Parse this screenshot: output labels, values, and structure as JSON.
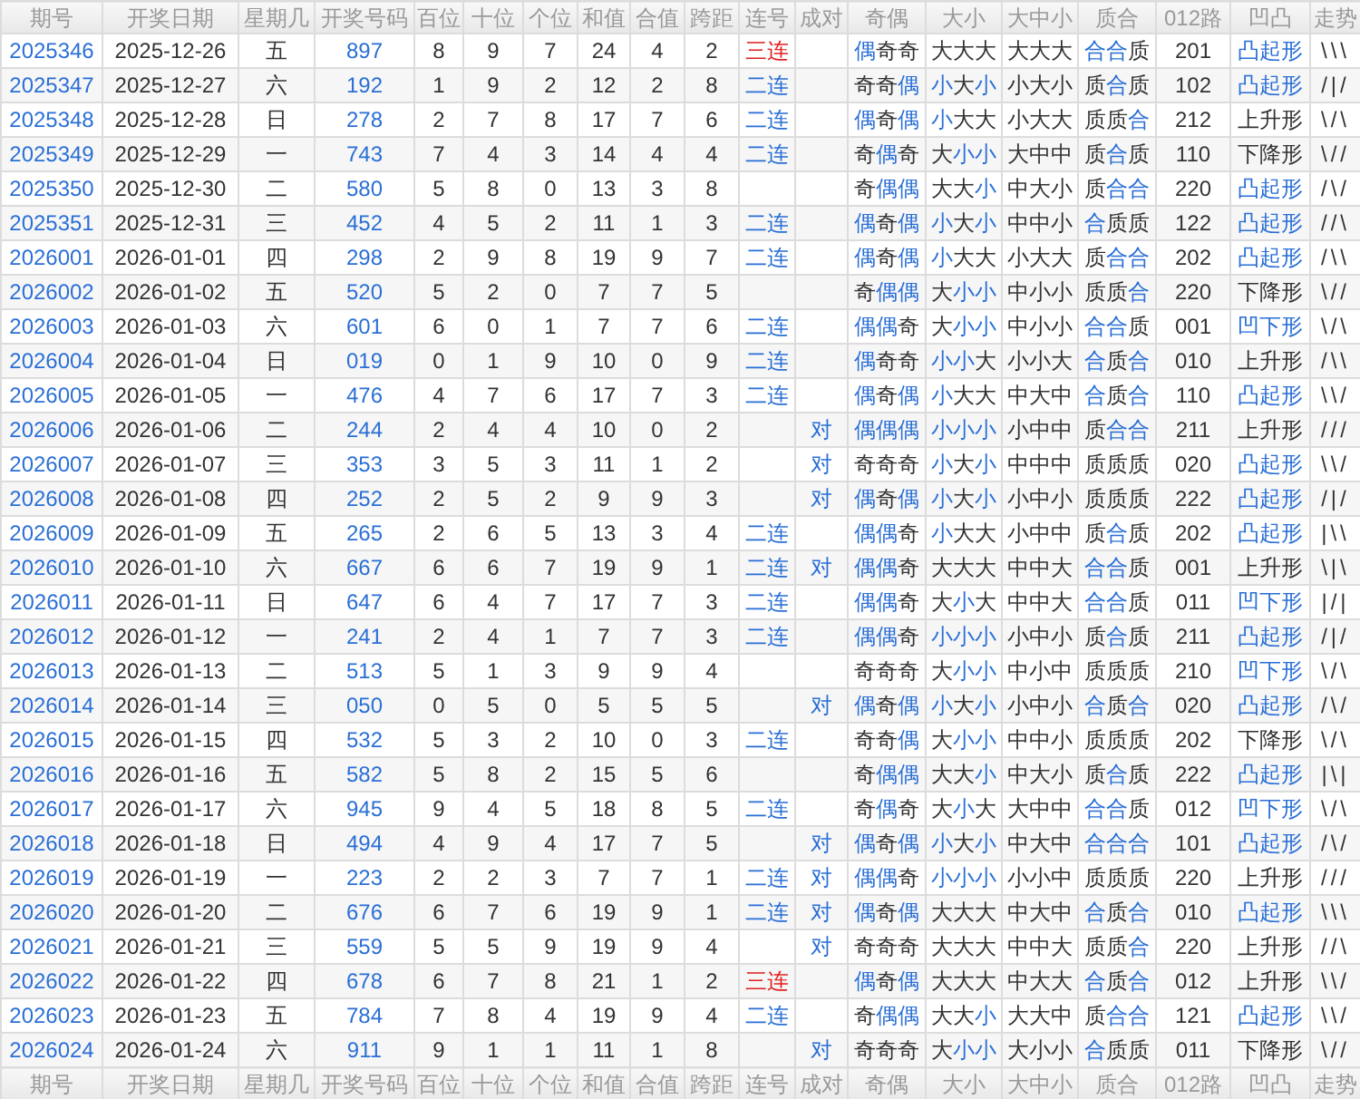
{
  "header": [
    "期号",
    "开奖日期",
    "星期几",
    "开奖号码",
    "百位",
    "十位",
    "个位",
    "和值",
    "合值",
    "跨距",
    "连号",
    "成对",
    "奇偶",
    "大小",
    "大中小",
    "质合",
    "012路",
    "凹凸",
    "走势"
  ],
  "rows": [
    {
      "issue": "2025346",
      "date": "2025-12-26",
      "weekday": "五",
      "number": "897",
      "hundreds": "8",
      "tens": "9",
      "units": "7",
      "sum": "24",
      "sum_tail": "4",
      "span": "2",
      "run": {
        "text": "三连",
        "kind": "triple"
      },
      "odd_even": {
        "text": "偶奇奇",
        "highlighted": [
          true,
          false,
          false
        ]
      },
      "big_small": {
        "text": "大大大",
        "highlighted": [
          false,
          false,
          false
        ]
      },
      "big_mid_small": "大大大",
      "prime_composite": {
        "text": "合合质",
        "highlighted": [
          true,
          true,
          false
        ]
      },
      "road_012": "201",
      "shape": {
        "text": "凸起形",
        "highlighted": true
      },
      "trend": "\\\\\\"
    },
    {
      "issue": "2025347",
      "date": "2025-12-27",
      "weekday": "六",
      "number": "192",
      "hundreds": "1",
      "tens": "9",
      "units": "2",
      "sum": "12",
      "sum_tail": "2",
      "span": "8",
      "run": {
        "text": "二连",
        "kind": "double"
      },
      "odd_even": {
        "text": "奇奇偶",
        "highlighted": [
          false,
          false,
          true
        ]
      },
      "big_small": {
        "text": "小大小",
        "highlighted": [
          true,
          false,
          true
        ]
      },
      "big_mid_small": "小大小",
      "prime_composite": {
        "text": "质合质",
        "highlighted": [
          false,
          true,
          false
        ]
      },
      "road_012": "102",
      "shape": {
        "text": "凸起形",
        "highlighted": true
      },
      "trend": "/|/"
    },
    {
      "issue": "2025348",
      "date": "2025-12-28",
      "weekday": "日",
      "number": "278",
      "hundreds": "2",
      "tens": "7",
      "units": "8",
      "sum": "17",
      "sum_tail": "7",
      "span": "6",
      "run": {
        "text": "二连",
        "kind": "double"
      },
      "odd_even": {
        "text": "偶奇偶",
        "highlighted": [
          true,
          false,
          true
        ]
      },
      "big_small": {
        "text": "小大大",
        "highlighted": [
          true,
          false,
          false
        ]
      },
      "big_mid_small": "小大大",
      "prime_composite": {
        "text": "质质合",
        "highlighted": [
          false,
          false,
          true
        ]
      },
      "road_012": "212",
      "shape": {
        "text": "上升形",
        "highlighted": false
      },
      "trend": "\\/\\"
    },
    {
      "issue": "2025349",
      "date": "2025-12-29",
      "weekday": "一",
      "number": "743",
      "hundreds": "7",
      "tens": "4",
      "units": "3",
      "sum": "14",
      "sum_tail": "4",
      "span": "4",
      "run": {
        "text": "二连",
        "kind": "double"
      },
      "odd_even": {
        "text": "奇偶奇",
        "highlighted": [
          false,
          true,
          false
        ]
      },
      "big_small": {
        "text": "大小小",
        "highlighted": [
          false,
          true,
          true
        ]
      },
      "big_mid_small": "大中中",
      "prime_composite": {
        "text": "质合质",
        "highlighted": [
          false,
          true,
          false
        ]
      },
      "road_012": "110",
      "shape": {
        "text": "下降形",
        "highlighted": false
      },
      "trend": "\\//"
    },
    {
      "issue": "2025350",
      "date": "2025-12-30",
      "weekday": "二",
      "number": "580",
      "hundreds": "5",
      "tens": "8",
      "units": "0",
      "sum": "13",
      "sum_tail": "3",
      "span": "8",
      "odd_even": {
        "text": "奇偶偶",
        "highlighted": [
          false,
          true,
          true
        ]
      },
      "big_small": {
        "text": "大大小",
        "highlighted": [
          false,
          false,
          true
        ]
      },
      "big_mid_small": "中大小",
      "prime_composite": {
        "text": "质合合",
        "highlighted": [
          false,
          true,
          true
        ]
      },
      "road_012": "220",
      "shape": {
        "text": "凸起形",
        "highlighted": true
      },
      "trend": "/\\/"
    },
    {
      "issue": "2025351",
      "date": "2025-12-31",
      "weekday": "三",
      "number": "452",
      "hundreds": "4",
      "tens": "5",
      "units": "2",
      "sum": "11",
      "sum_tail": "1",
      "span": "3",
      "run": {
        "text": "二连",
        "kind": "double"
      },
      "odd_even": {
        "text": "偶奇偶",
        "highlighted": [
          true,
          false,
          true
        ]
      },
      "big_small": {
        "text": "小大小",
        "highlighted": [
          true,
          false,
          true
        ]
      },
      "big_mid_small": "中中小",
      "prime_composite": {
        "text": "合质质",
        "highlighted": [
          true,
          false,
          false
        ]
      },
      "road_012": "122",
      "shape": {
        "text": "凸起形",
        "highlighted": true
      },
      "trend": "//\\"
    },
    {
      "issue": "2026001",
      "date": "2026-01-01",
      "weekday": "四",
      "number": "298",
      "hundreds": "2",
      "tens": "9",
      "units": "8",
      "sum": "19",
      "sum_tail": "9",
      "span": "7",
      "run": {
        "text": "二连",
        "kind": "double"
      },
      "odd_even": {
        "text": "偶奇偶",
        "highlighted": [
          true,
          false,
          true
        ]
      },
      "big_small": {
        "text": "小大大",
        "highlighted": [
          true,
          false,
          false
        ]
      },
      "big_mid_small": "小大大",
      "prime_composite": {
        "text": "质合合",
        "highlighted": [
          false,
          true,
          true
        ]
      },
      "road_012": "202",
      "shape": {
        "text": "凸起形",
        "highlighted": true
      },
      "trend": "/\\\\"
    },
    {
      "issue": "2026002",
      "date": "2026-01-02",
      "weekday": "五",
      "number": "520",
      "hundreds": "5",
      "tens": "2",
      "units": "0",
      "sum": "7",
      "sum_tail": "7",
      "span": "5",
      "odd_even": {
        "text": "奇偶偶",
        "highlighted": [
          false,
          true,
          true
        ]
      },
      "big_small": {
        "text": "大小小",
        "highlighted": [
          false,
          true,
          true
        ]
      },
      "big_mid_small": "中小小",
      "prime_composite": {
        "text": "质质合",
        "highlighted": [
          false,
          false,
          true
        ]
      },
      "road_012": "220",
      "shape": {
        "text": "下降形",
        "highlighted": false
      },
      "trend": "\\//"
    },
    {
      "issue": "2026003",
      "date": "2026-01-03",
      "weekday": "六",
      "number": "601",
      "hundreds": "6",
      "tens": "0",
      "units": "1",
      "sum": "7",
      "sum_tail": "7",
      "span": "6",
      "run": {
        "text": "二连",
        "kind": "double"
      },
      "odd_even": {
        "text": "偶偶奇",
        "highlighted": [
          true,
          true,
          false
        ]
      },
      "big_small": {
        "text": "大小小",
        "highlighted": [
          false,
          true,
          true
        ]
      },
      "big_mid_small": "中小小",
      "prime_composite": {
        "text": "合合质",
        "highlighted": [
          true,
          true,
          false
        ]
      },
      "road_012": "001",
      "shape": {
        "text": "凹下形",
        "highlighted": true
      },
      "trend": "\\/\\"
    },
    {
      "issue": "2026004",
      "date": "2026-01-04",
      "weekday": "日",
      "number": "019",
      "hundreds": "0",
      "tens": "1",
      "units": "9",
      "sum": "10",
      "sum_tail": "0",
      "span": "9",
      "run": {
        "text": "二连",
        "kind": "double"
      },
      "odd_even": {
        "text": "偶奇奇",
        "highlighted": [
          true,
          false,
          false
        ]
      },
      "big_small": {
        "text": "小小大",
        "highlighted": [
          true,
          true,
          false
        ]
      },
      "big_mid_small": "小小大",
      "prime_composite": {
        "text": "合质合",
        "highlighted": [
          true,
          false,
          true
        ]
      },
      "road_012": "010",
      "shape": {
        "text": "上升形",
        "highlighted": false
      },
      "trend": "/\\\\"
    },
    {
      "issue": "2026005",
      "date": "2026-01-05",
      "weekday": "一",
      "number": "476",
      "hundreds": "4",
      "tens": "7",
      "units": "6",
      "sum": "17",
      "sum_tail": "7",
      "span": "3",
      "run": {
        "text": "二连",
        "kind": "double"
      },
      "odd_even": {
        "text": "偶奇偶",
        "highlighted": [
          true,
          false,
          true
        ]
      },
      "big_small": {
        "text": "小大大",
        "highlighted": [
          true,
          false,
          false
        ]
      },
      "big_mid_small": "中大中",
      "prime_composite": {
        "text": "合质合",
        "highlighted": [
          true,
          false,
          true
        ]
      },
      "road_012": "110",
      "shape": {
        "text": "凸起形",
        "highlighted": true
      },
      "trend": "\\\\/"
    },
    {
      "issue": "2026006",
      "date": "2026-01-06",
      "weekday": "二",
      "number": "244",
      "hundreds": "2",
      "tens": "4",
      "units": "4",
      "sum": "10",
      "sum_tail": "0",
      "span": "2",
      "pair": "对",
      "odd_even": {
        "text": "偶偶偶",
        "highlighted": [
          true,
          true,
          true
        ]
      },
      "big_small": {
        "text": "小小小",
        "highlighted": [
          true,
          true,
          true
        ]
      },
      "big_mid_small": "小中中",
      "prime_composite": {
        "text": "质合合",
        "highlighted": [
          false,
          true,
          true
        ]
      },
      "road_012": "211",
      "shape": {
        "text": "上升形",
        "highlighted": false
      },
      "trend": "///"
    },
    {
      "issue": "2026007",
      "date": "2026-01-07",
      "weekday": "三",
      "number": "353",
      "hundreds": "3",
      "tens": "5",
      "units": "3",
      "sum": "11",
      "sum_tail": "1",
      "span": "2",
      "pair": "对",
      "odd_even": {
        "text": "奇奇奇",
        "highlighted": [
          false,
          false,
          false
        ]
      },
      "big_small": {
        "text": "小大小",
        "highlighted": [
          true,
          false,
          true
        ]
      },
      "big_mid_small": "中中中",
      "prime_composite": {
        "text": "质质质",
        "highlighted": [
          false,
          false,
          false
        ]
      },
      "road_012": "020",
      "shape": {
        "text": "凸起形",
        "highlighted": true
      },
      "trend": "\\\\/"
    },
    {
      "issue": "2026008",
      "date": "2026-01-08",
      "weekday": "四",
      "number": "252",
      "hundreds": "2",
      "tens": "5",
      "units": "2",
      "sum": "9",
      "sum_tail": "9",
      "span": "3",
      "pair": "对",
      "odd_even": {
        "text": "偶奇偶",
        "highlighted": [
          true,
          false,
          true
        ]
      },
      "big_small": {
        "text": "小大小",
        "highlighted": [
          true,
          false,
          true
        ]
      },
      "big_mid_small": "小中小",
      "prime_composite": {
        "text": "质质质",
        "highlighted": [
          false,
          false,
          false
        ]
      },
      "road_012": "222",
      "shape": {
        "text": "凸起形",
        "highlighted": true
      },
      "trend": "/|/"
    },
    {
      "issue": "2026009",
      "date": "2026-01-09",
      "weekday": "五",
      "number": "265",
      "hundreds": "2",
      "tens": "6",
      "units": "5",
      "sum": "13",
      "sum_tail": "3",
      "span": "4",
      "run": {
        "text": "二连",
        "kind": "double"
      },
      "odd_even": {
        "text": "偶偶奇",
        "highlighted": [
          true,
          true,
          false
        ]
      },
      "big_small": {
        "text": "小大大",
        "highlighted": [
          true,
          false,
          false
        ]
      },
      "big_mid_small": "小中中",
      "prime_composite": {
        "text": "质合质",
        "highlighted": [
          false,
          true,
          false
        ]
      },
      "road_012": "202",
      "shape": {
        "text": "凸起形",
        "highlighted": true
      },
      "trend": "|\\\\"
    },
    {
      "issue": "2026010",
      "date": "2026-01-10",
      "weekday": "六",
      "number": "667",
      "hundreds": "6",
      "tens": "6",
      "units": "7",
      "sum": "19",
      "sum_tail": "9",
      "span": "1",
      "run": {
        "text": "二连",
        "kind": "double"
      },
      "pair": "对",
      "odd_even": {
        "text": "偶偶奇",
        "highlighted": [
          true,
          true,
          false
        ]
      },
      "big_small": {
        "text": "大大大",
        "highlighted": [
          false,
          false,
          false
        ]
      },
      "big_mid_small": "中中大",
      "prime_composite": {
        "text": "合合质",
        "highlighted": [
          true,
          true,
          false
        ]
      },
      "road_012": "001",
      "shape": {
        "text": "上升形",
        "highlighted": false
      },
      "trend": "\\|\\"
    },
    {
      "issue": "2026011",
      "date": "2026-01-11",
      "weekday": "日",
      "number": "647",
      "hundreds": "6",
      "tens": "4",
      "units": "7",
      "sum": "17",
      "sum_tail": "7",
      "span": "3",
      "run": {
        "text": "二连",
        "kind": "double"
      },
      "odd_even": {
        "text": "偶偶奇",
        "highlighted": [
          true,
          true,
          false
        ]
      },
      "big_small": {
        "text": "大小大",
        "highlighted": [
          false,
          true,
          false
        ]
      },
      "big_mid_small": "中中大",
      "prime_composite": {
        "text": "合合质",
        "highlighted": [
          true,
          true,
          false
        ]
      },
      "road_012": "011",
      "shape": {
        "text": "凹下形",
        "highlighted": true
      },
      "trend": "|/|"
    },
    {
      "issue": "2026012",
      "date": "2026-01-12",
      "weekday": "一",
      "number": "241",
      "hundreds": "2",
      "tens": "4",
      "units": "1",
      "sum": "7",
      "sum_tail": "7",
      "span": "3",
      "run": {
        "text": "二连",
        "kind": "double"
      },
      "odd_even": {
        "text": "偶偶奇",
        "highlighted": [
          true,
          true,
          false
        ]
      },
      "big_small": {
        "text": "小小小",
        "highlighted": [
          true,
          true,
          true
        ]
      },
      "big_mid_small": "小中小",
      "prime_composite": {
        "text": "质合质",
        "highlighted": [
          false,
          true,
          false
        ]
      },
      "road_012": "211",
      "shape": {
        "text": "凸起形",
        "highlighted": true
      },
      "trend": "/|/"
    },
    {
      "issue": "2026013",
      "date": "2026-01-13",
      "weekday": "二",
      "number": "513",
      "hundreds": "5",
      "tens": "1",
      "units": "3",
      "sum": "9",
      "sum_tail": "9",
      "span": "4",
      "odd_even": {
        "text": "奇奇奇",
        "highlighted": [
          false,
          false,
          false
        ]
      },
      "big_small": {
        "text": "大小小",
        "highlighted": [
          false,
          true,
          true
        ]
      },
      "big_mid_small": "中小中",
      "prime_composite": {
        "text": "质质质",
        "highlighted": [
          false,
          false,
          false
        ]
      },
      "road_012": "210",
      "shape": {
        "text": "凹下形",
        "highlighted": true
      },
      "trend": "\\/\\"
    },
    {
      "issue": "2026014",
      "date": "2026-01-14",
      "weekday": "三",
      "number": "050",
      "hundreds": "0",
      "tens": "5",
      "units": "0",
      "sum": "5",
      "sum_tail": "5",
      "span": "5",
      "pair": "对",
      "odd_even": {
        "text": "偶奇偶",
        "highlighted": [
          true,
          false,
          true
        ]
      },
      "big_small": {
        "text": "小大小",
        "highlighted": [
          true,
          false,
          true
        ]
      },
      "big_mid_small": "小中小",
      "prime_composite": {
        "text": "合质合",
        "highlighted": [
          true,
          false,
          true
        ]
      },
      "road_012": "020",
      "shape": {
        "text": "凸起形",
        "highlighted": true
      },
      "trend": "/\\/"
    },
    {
      "issue": "2026015",
      "date": "2026-01-15",
      "weekday": "四",
      "number": "532",
      "hundreds": "5",
      "tens": "3",
      "units": "2",
      "sum": "10",
      "sum_tail": "0",
      "span": "3",
      "run": {
        "text": "二连",
        "kind": "double"
      },
      "odd_even": {
        "text": "奇奇偶",
        "highlighted": [
          false,
          false,
          true
        ]
      },
      "big_small": {
        "text": "大小小",
        "highlighted": [
          false,
          true,
          true
        ]
      },
      "big_mid_small": "中中小",
      "prime_composite": {
        "text": "质质质",
        "highlighted": [
          false,
          false,
          false
        ]
      },
      "road_012": "202",
      "shape": {
        "text": "下降形",
        "highlighted": false
      },
      "trend": "\\/\\"
    },
    {
      "issue": "2026016",
      "date": "2026-01-16",
      "weekday": "五",
      "number": "582",
      "hundreds": "5",
      "tens": "8",
      "units": "2",
      "sum": "15",
      "sum_tail": "5",
      "span": "6",
      "odd_even": {
        "text": "奇偶偶",
        "highlighted": [
          false,
          true,
          true
        ]
      },
      "big_small": {
        "text": "大大小",
        "highlighted": [
          false,
          false,
          true
        ]
      },
      "big_mid_small": "中大小",
      "prime_composite": {
        "text": "质合质",
        "highlighted": [
          false,
          true,
          false
        ]
      },
      "road_012": "222",
      "shape": {
        "text": "凸起形",
        "highlighted": true
      },
      "trend": "|\\|"
    },
    {
      "issue": "2026017",
      "date": "2026-01-17",
      "weekday": "六",
      "number": "945",
      "hundreds": "9",
      "tens": "4",
      "units": "5",
      "sum": "18",
      "sum_tail": "8",
      "span": "5",
      "run": {
        "text": "二连",
        "kind": "double"
      },
      "odd_even": {
        "text": "奇偶奇",
        "highlighted": [
          false,
          true,
          false
        ]
      },
      "big_small": {
        "text": "大小大",
        "highlighted": [
          false,
          true,
          false
        ]
      },
      "big_mid_small": "大中中",
      "prime_composite": {
        "text": "合合质",
        "highlighted": [
          true,
          true,
          false
        ]
      },
      "road_012": "012",
      "shape": {
        "text": "凹下形",
        "highlighted": true
      },
      "trend": "\\/\\"
    },
    {
      "issue": "2026018",
      "date": "2026-01-18",
      "weekday": "日",
      "number": "494",
      "hundreds": "4",
      "tens": "9",
      "units": "4",
      "sum": "17",
      "sum_tail": "7",
      "span": "5",
      "pair": "对",
      "odd_even": {
        "text": "偶奇偶",
        "highlighted": [
          true,
          false,
          true
        ]
      },
      "big_small": {
        "text": "小大小",
        "highlighted": [
          true,
          false,
          true
        ]
      },
      "big_mid_small": "中大中",
      "prime_composite": {
        "text": "合合合",
        "highlighted": [
          true,
          true,
          true
        ]
      },
      "road_012": "101",
      "shape": {
        "text": "凸起形",
        "highlighted": true
      },
      "trend": "/\\/"
    },
    {
      "issue": "2026019",
      "date": "2026-01-19",
      "weekday": "一",
      "number": "223",
      "hundreds": "2",
      "tens": "2",
      "units": "3",
      "sum": "7",
      "sum_tail": "7",
      "span": "1",
      "run": {
        "text": "二连",
        "kind": "double"
      },
      "pair": "对",
      "odd_even": {
        "text": "偶偶奇",
        "highlighted": [
          true,
          true,
          false
        ]
      },
      "big_small": {
        "text": "小小小",
        "highlighted": [
          true,
          true,
          true
        ]
      },
      "big_mid_small": "小小中",
      "prime_composite": {
        "text": "质质质",
        "highlighted": [
          false,
          false,
          false
        ]
      },
      "road_012": "220",
      "shape": {
        "text": "上升形",
        "highlighted": false
      },
      "trend": "///"
    },
    {
      "issue": "2026020",
      "date": "2026-01-20",
      "weekday": "二",
      "number": "676",
      "hundreds": "6",
      "tens": "7",
      "units": "6",
      "sum": "19",
      "sum_tail": "9",
      "span": "1",
      "run": {
        "text": "二连",
        "kind": "double"
      },
      "pair": "对",
      "odd_even": {
        "text": "偶奇偶",
        "highlighted": [
          true,
          false,
          true
        ]
      },
      "big_small": {
        "text": "大大大",
        "highlighted": [
          false,
          false,
          false
        ]
      },
      "big_mid_small": "中大中",
      "prime_composite": {
        "text": "合质合",
        "highlighted": [
          true,
          false,
          true
        ]
      },
      "road_012": "010",
      "shape": {
        "text": "凸起形",
        "highlighted": true
      },
      "trend": "\\\\\\"
    },
    {
      "issue": "2026021",
      "date": "2026-01-21",
      "weekday": "三",
      "number": "559",
      "hundreds": "5",
      "tens": "5",
      "units": "9",
      "sum": "19",
      "sum_tail": "9",
      "span": "4",
      "pair": "对",
      "odd_even": {
        "text": "奇奇奇",
        "highlighted": [
          false,
          false,
          false
        ]
      },
      "big_small": {
        "text": "大大大",
        "highlighted": [
          false,
          false,
          false
        ]
      },
      "big_mid_small": "中中大",
      "prime_composite": {
        "text": "质质合",
        "highlighted": [
          false,
          false,
          true
        ]
      },
      "road_012": "220",
      "shape": {
        "text": "上升形",
        "highlighted": false
      },
      "trend": "//\\"
    },
    {
      "issue": "2026022",
      "date": "2026-01-22",
      "weekday": "四",
      "number": "678",
      "hundreds": "6",
      "tens": "7",
      "units": "8",
      "sum": "21",
      "sum_tail": "1",
      "span": "2",
      "run": {
        "text": "三连",
        "kind": "triple"
      },
      "odd_even": {
        "text": "偶奇偶",
        "highlighted": [
          true,
          false,
          true
        ]
      },
      "big_small": {
        "text": "大大大",
        "highlighted": [
          false,
          false,
          false
        ]
      },
      "big_mid_small": "中大大",
      "prime_composite": {
        "text": "合质合",
        "highlighted": [
          true,
          false,
          true
        ]
      },
      "road_012": "012",
      "shape": {
        "text": "上升形",
        "highlighted": false
      },
      "trend": "\\\\/"
    },
    {
      "issue": "2026023",
      "date": "2026-01-23",
      "weekday": "五",
      "number": "784",
      "hundreds": "7",
      "tens": "8",
      "units": "4",
      "sum": "19",
      "sum_tail": "9",
      "span": "4",
      "run": {
        "text": "二连",
        "kind": "double"
      },
      "odd_even": {
        "text": "奇偶偶",
        "highlighted": [
          false,
          true,
          true
        ]
      },
      "big_small": {
        "text": "大大小",
        "highlighted": [
          false,
          false,
          true
        ]
      },
      "big_mid_small": "大大中",
      "prime_composite": {
        "text": "质合合",
        "highlighted": [
          false,
          true,
          true
        ]
      },
      "road_012": "121",
      "shape": {
        "text": "凸起形",
        "highlighted": true
      },
      "trend": "\\\\/"
    },
    {
      "issue": "2026024",
      "date": "2026-01-24",
      "weekday": "六",
      "number": "911",
      "hundreds": "9",
      "tens": "1",
      "units": "1",
      "sum": "11",
      "sum_tail": "1",
      "span": "8",
      "pair": "对",
      "odd_even": {
        "text": "奇奇奇",
        "highlighted": [
          false,
          false,
          false
        ]
      },
      "big_small": {
        "text": "大小小",
        "highlighted": [
          false,
          true,
          true
        ]
      },
      "big_mid_small": "大小小",
      "prime_composite": {
        "text": "合质质",
        "highlighted": [
          true,
          false,
          false
        ]
      },
      "road_012": "011",
      "shape": {
        "text": "下降形",
        "highlighted": false
      },
      "trend": "\\//"
    }
  ],
  "footer": [
    "期号",
    "开奖日期",
    "星期几",
    "开奖号码",
    "百位",
    "十位",
    "个位",
    "和值",
    "合值",
    "跨距",
    "连号",
    "成对",
    "奇偶",
    "大小",
    "大中小",
    "质合",
    "012路",
    "凹凸",
    "走势"
  ]
}
